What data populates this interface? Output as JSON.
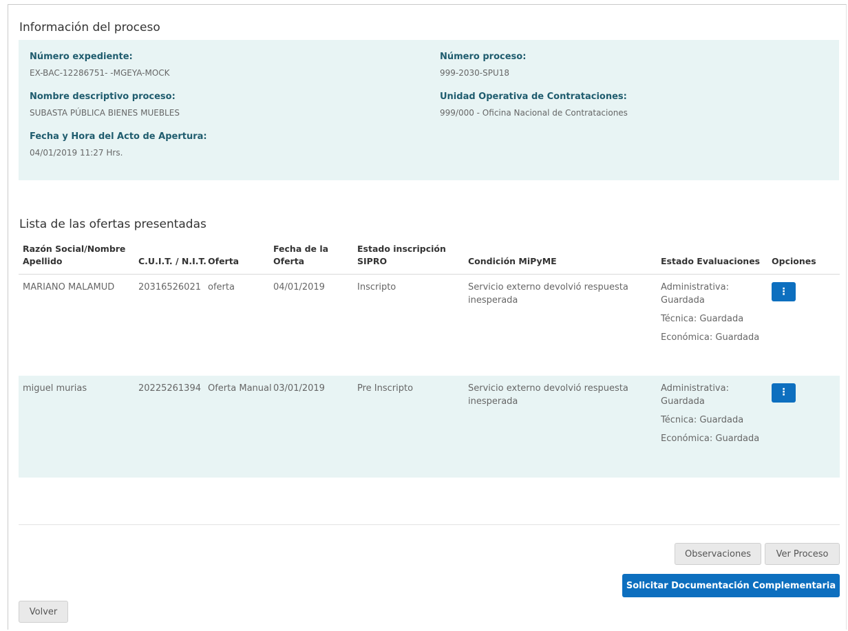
{
  "process_info": {
    "title": "Información del proceso",
    "fields": {
      "numero_expediente": {
        "label": "Número expediente:",
        "value": "EX-BAC-12286751- -MGEYA-MOCK"
      },
      "numero_proceso": {
        "label": "Número proceso:",
        "value": "999-2030-SPU18"
      },
      "nombre_descriptivo": {
        "label": "Nombre descriptivo proceso:",
        "value": "SUBASTA PÚBLICA BIENES MUEBLES"
      },
      "unidad_operativa": {
        "label": "Unidad Operativa de Contrataciones:",
        "value": "999/000 - Oficina Nacional de Contrataciones"
      },
      "fecha_apertura": {
        "label": "Fecha y Hora del Acto de Apertura:",
        "value": "04/01/2019 11:27 Hrs."
      }
    }
  },
  "offers": {
    "title": "Lista de las ofertas presentadas",
    "headers": {
      "razon_social": "Razón Social/Nombre Apellido",
      "cuit": "C.U.I.T. / N.I.T.",
      "oferta": "Oferta",
      "fecha": "Fecha de la Oferta",
      "estado_sipro": "Estado inscripción SIPRO",
      "condicion": "Condición MiPyME",
      "estado_eval": "Estado Evaluaciones",
      "opciones": "Opciones"
    },
    "rows": [
      {
        "razon_social": "MARIANO MALAMUD",
        "cuit": "20316526021",
        "oferta": "oferta",
        "fecha": "04/01/2019",
        "estado_sipro": "Inscripto",
        "condicion": "Servicio externo devolvió respuesta inesperada",
        "eval_administrativa": "Administrativa: Guardada",
        "eval_tecnica": "Técnica: Guardada",
        "eval_economica": "Económica: Guardada",
        "options_icon": "⋮"
      },
      {
        "razon_social": "miguel murias",
        "cuit": "20225261394",
        "oferta": "Oferta Manual",
        "fecha": "03/01/2019",
        "estado_sipro": "Pre Inscripto",
        "condicion": "Servicio externo devolvió respuesta inesperada",
        "eval_administrativa": "Administrativa: Guardada",
        "eval_tecnica": "Técnica: Guardada",
        "eval_economica": "Económica: Guardada",
        "options_icon": "⋮"
      }
    ]
  },
  "actions": {
    "observaciones": "Observaciones",
    "ver_proceso": "Ver Proceso",
    "solicitar_doc": "Solicitar Documentación Complementaria",
    "volver": "Volver"
  },
  "colors": {
    "accent_blue": "#0d6fbf",
    "panel_bg": "#e8f4f4",
    "label_teal": "#1f5c6e"
  }
}
